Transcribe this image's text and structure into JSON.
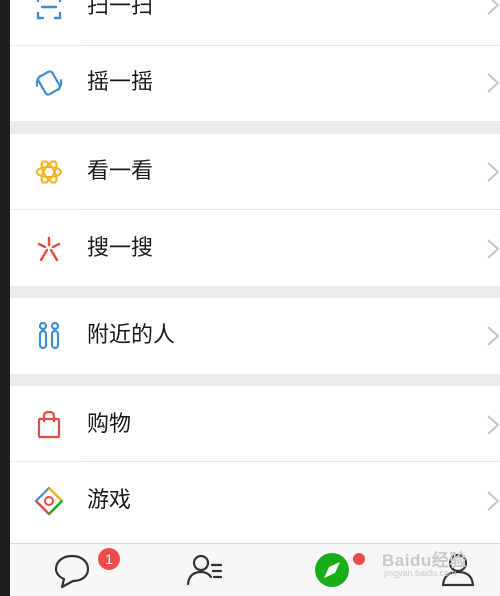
{
  "menu": {
    "items": [
      {
        "id": "scan",
        "label": "扫一扫",
        "icon": "scan-icon"
      },
      {
        "id": "shake",
        "label": "摇一摇",
        "icon": "shake-icon"
      },
      {
        "id": "look",
        "label": "看一看",
        "icon": "look-icon"
      },
      {
        "id": "search",
        "label": "搜一搜",
        "icon": "search-icon"
      },
      {
        "id": "nearby",
        "label": "附近的人",
        "icon": "people-nearby-icon"
      },
      {
        "id": "shopping",
        "label": "购物",
        "icon": "shopping-bag-icon"
      },
      {
        "id": "games",
        "label": "游戏",
        "icon": "games-icon"
      }
    ],
    "chevron_icon": "chevron-right-icon"
  },
  "tabbar": {
    "tabs": [
      {
        "id": "chats",
        "icon": "chat-bubble-icon",
        "badge": "1"
      },
      {
        "id": "contacts",
        "icon": "contacts-icon"
      },
      {
        "id": "discover",
        "icon": "compass-icon",
        "dot": true,
        "active": true
      },
      {
        "id": "me",
        "icon": "person-icon"
      }
    ]
  },
  "watermark": {
    "line1": "Baidu经验",
    "line2": "jingyan.baidu.com"
  },
  "colors": {
    "accent_green": "#1aad19",
    "badge_red": "#f04b4b",
    "background": "#ebebeb",
    "row_bg": "#ffffff"
  }
}
